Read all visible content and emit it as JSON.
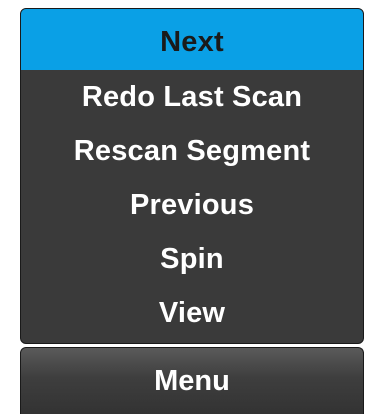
{
  "menu": {
    "items": [
      {
        "label": "Next",
        "selected": true
      },
      {
        "label": "Redo Last Scan",
        "selected": false
      },
      {
        "label": "Rescan Segment",
        "selected": false
      },
      {
        "label": "Previous",
        "selected": false
      },
      {
        "label": "Spin",
        "selected": false
      },
      {
        "label": "View",
        "selected": false
      }
    ]
  },
  "menu_button": {
    "label": "Menu"
  },
  "colors": {
    "selected_background": "#0aa0e6",
    "panel_background": "#3a3a3a",
    "text": "#ffffff"
  }
}
